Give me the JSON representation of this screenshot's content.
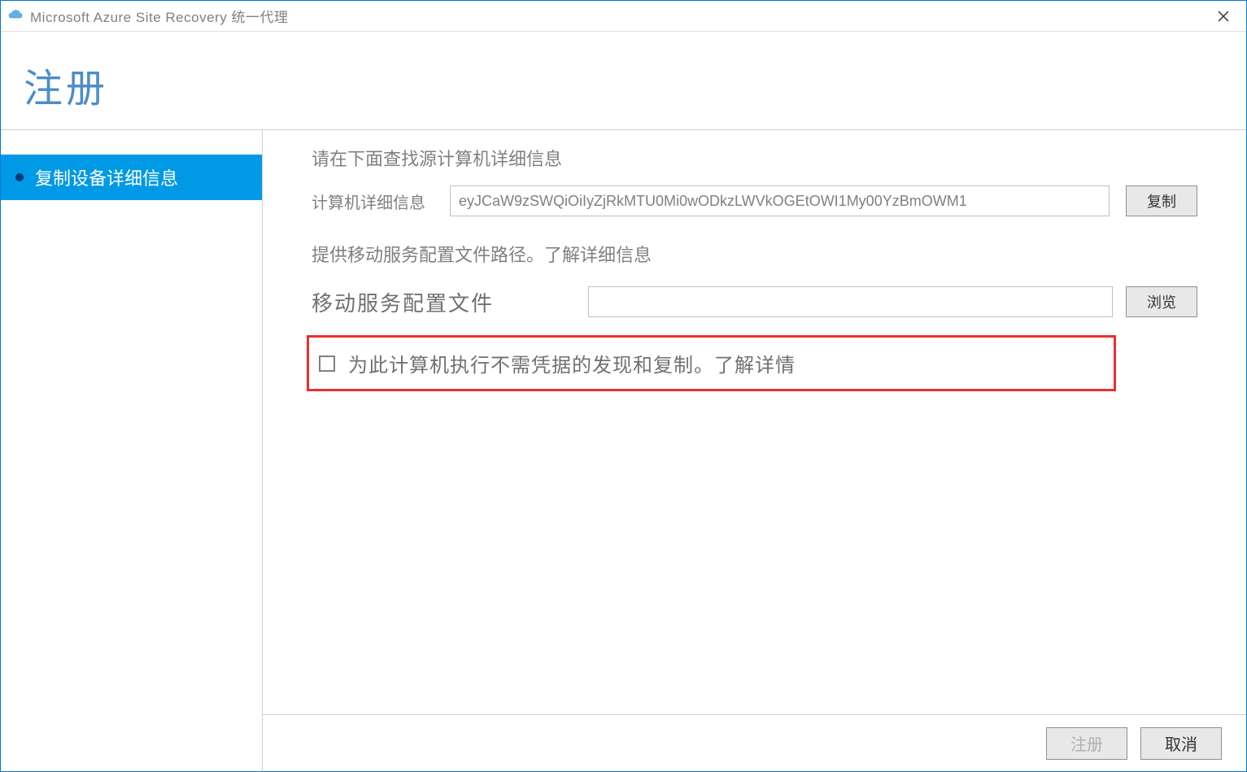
{
  "titlebar": {
    "app_name": "Microsoft Azure Site Recovery 统一代理"
  },
  "header": {
    "title": "注册"
  },
  "sidebar": {
    "items": [
      {
        "label": "复制设备详细信息",
        "active": true
      }
    ]
  },
  "form": {
    "instruction1": "请在下面查找源计算机详细信息",
    "machine_details_label": "计算机详细信息",
    "machine_details_value": "eyJCaW9zSWQiOiIyZjRkMTU0Mi0wODkzLWVkOGEtOWI1My00YzBmOWM1",
    "copy_button": "复制",
    "instruction2": "提供移动服务配置文件路径。了解详细信息",
    "config_file_label": "移动服务配置文件",
    "config_file_value": "",
    "browse_button": "浏览",
    "checkbox_label": "为此计算机执行不需凭据的发现和复制。了解详情",
    "checkbox_checked": false
  },
  "footer": {
    "register_button": "注册",
    "cancel_button": "取消"
  }
}
